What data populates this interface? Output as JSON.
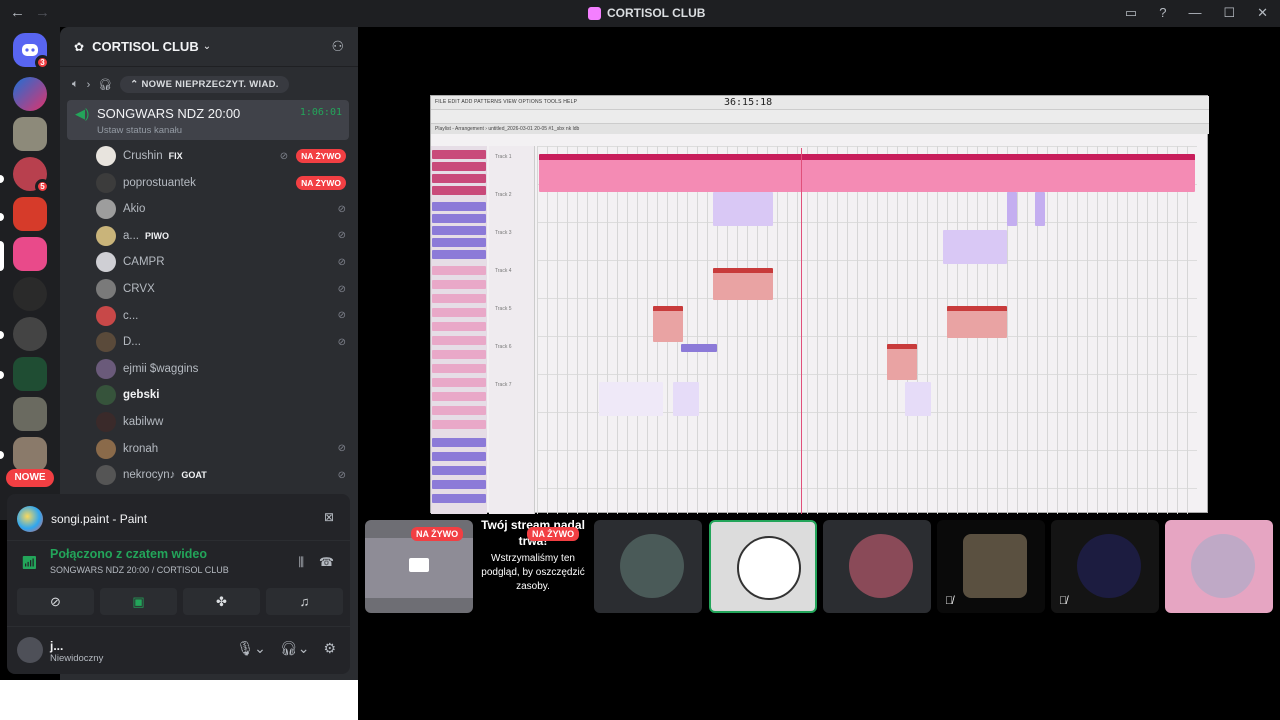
{
  "titlebar": {
    "title": "CORTISOL CLUB",
    "back_icon": "←",
    "forward_icon": "→",
    "minimize": "—",
    "maximize": "☐",
    "close": "✕"
  },
  "guilds": {
    "home_badge": "3",
    "badge_2": "5",
    "new_label": "NOWE"
  },
  "server": {
    "name": "CORTISOL CLUB",
    "unread_label": "NOWE NIEPRZECZYT. WIAD."
  },
  "voice_channel": {
    "name": "SONGWARS NDZ 20:00",
    "timer": "1:06:01",
    "status": "Ustaw status kanału"
  },
  "members": [
    {
      "name": "Crushin",
      "tag": "FIX",
      "live": true,
      "muted": true
    },
    {
      "name": "poprostuantek",
      "tag": "",
      "live": true,
      "muted": false
    },
    {
      "name": "Akio",
      "tag": "",
      "live": false,
      "muted": true
    },
    {
      "name": "a...",
      "tag": "PIWO",
      "live": false,
      "muted": true
    },
    {
      "name": "CAMPR",
      "tag": "",
      "live": false,
      "muted": true
    },
    {
      "name": "CRVX",
      "tag": "",
      "live": false,
      "muted": true
    },
    {
      "name": "c...",
      "tag": "",
      "live": false,
      "muted": true
    },
    {
      "name": "D...",
      "tag": "",
      "live": false,
      "muted": true
    },
    {
      "name": "ejmii $waggins",
      "tag": "",
      "live": false,
      "muted": false
    },
    {
      "name": "gebski",
      "tag": "",
      "live": false,
      "muted": false,
      "bright": true
    },
    {
      "name": "kabilww",
      "tag": "",
      "live": false,
      "muted": false
    },
    {
      "name": "kronah",
      "tag": "",
      "live": false,
      "muted": true
    },
    {
      "name": "nekrocyn♪",
      "tag": "GOAT",
      "live": false,
      "muted": true
    }
  ],
  "live_label": "NA ŻYWO",
  "overlay": {
    "app": "songi.paint - Paint",
    "connected": "Połączono z czatem wideo",
    "channel_path": "SONGWARS NDZ 20:00 / CORTISOL CLUB"
  },
  "user": {
    "name": "j...",
    "status": "Niewidoczny"
  },
  "stream": {
    "clock": "36:15:18",
    "menu": "FILE EDIT ADD PATTERNS VIEW OPTIONS TOOLS HELP",
    "tab": "Playlist - Arrangement › untitled_2026-03-01 20-05 #1_sbx nk ldb",
    "tracks": [
      "Track 1",
      "Track 2",
      "Track 3",
      "Track 4",
      "Track 5",
      "Track 6",
      "Track 7"
    ]
  },
  "paused_tile": {
    "title": "Twój stream nadal trwa!",
    "body": "Wstrzymaliśmy ten podgląd, by oszczędzić zasoby."
  },
  "colors": {
    "green": "#23a55a",
    "red": "#f23f43",
    "pink": "#e94a8a",
    "purple": "#9b7ee0"
  }
}
